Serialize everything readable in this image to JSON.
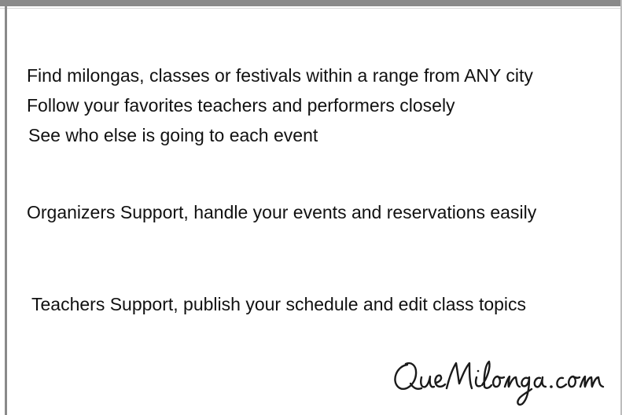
{
  "features": {
    "line1": "Find milongas, classes or festivals within a range from ANY city",
    "line2": "Follow your favorites teachers and performers closely",
    "line3": "See who else is going to each event"
  },
  "organizers": {
    "text": "Organizers Support, handle your events and reservations easily"
  },
  "teachers": {
    "text": "Teachers Support, publish your schedule and edit class topics"
  },
  "brand": {
    "logo_text": "QueMilonga.com"
  }
}
